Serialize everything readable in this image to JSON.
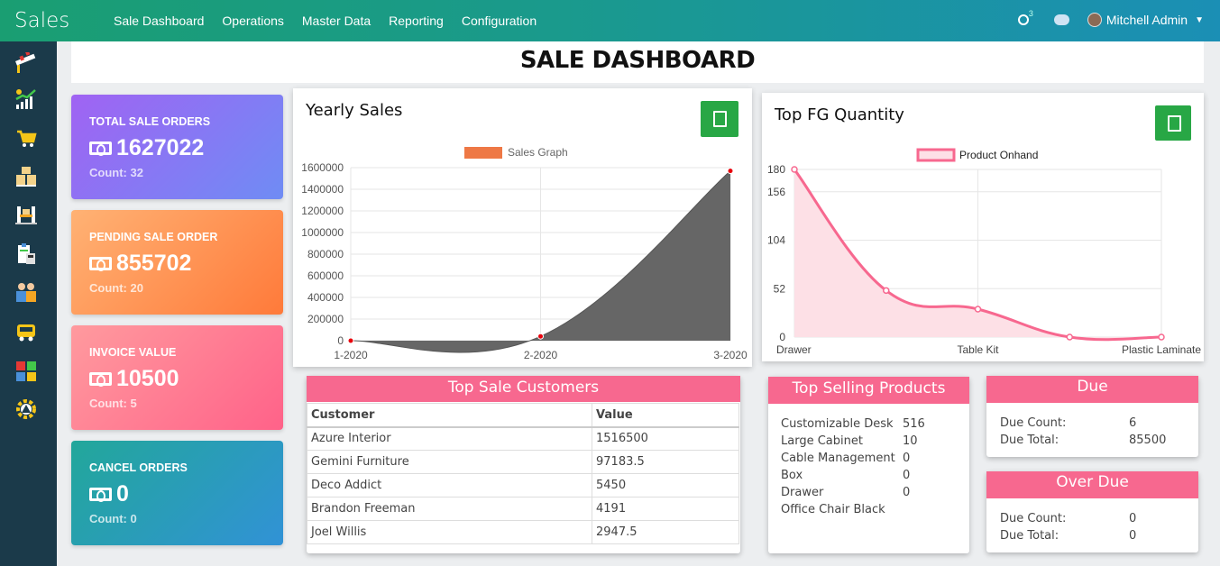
{
  "app": {
    "title": "Sales"
  },
  "topnav": [
    "Sale Dashboard",
    "Operations",
    "Master Data",
    "Reporting",
    "Configuration"
  ],
  "user": {
    "name": "Mitchell Admin",
    "activity_count": "3"
  },
  "page_title": "SALE DASHBOARD",
  "cards": [
    {
      "label": "TOTAL SALE ORDERS",
      "value": "1627022",
      "count": "Count: 32"
    },
    {
      "label": "PENDING SALE ORDER",
      "value": "855702",
      "count": "Count: 20"
    },
    {
      "label": "INVOICE VALUE",
      "value": "10500",
      "count": "Count: 5"
    },
    {
      "label": "CANCEL ORDERS",
      "value": "0",
      "count": "Count: 0"
    }
  ],
  "yearly": {
    "title": "Yearly Sales"
  },
  "topfg": {
    "title": "Top FG Quantity"
  },
  "chart_data": [
    {
      "type": "area",
      "title": "Yearly Sales",
      "legend": "Sales Graph",
      "x": [
        "1-2020",
        "2-2020",
        "3-2020"
      ],
      "values": [
        0,
        40000,
        1570000
      ],
      "ylim": [
        0,
        1600000
      ],
      "yticks": [
        "0",
        "200000",
        "400000",
        "600000",
        "800000",
        "1000000",
        "1200000",
        "1400000",
        "1600000"
      ],
      "colors": {
        "fill": "#666666",
        "legend": "#ee7845",
        "point": "#e8000b"
      }
    },
    {
      "type": "area",
      "title": "Top FG Quantity",
      "legend": "Product Onhand",
      "x": [
        "Drawer",
        "",
        "Table Kit",
        "",
        "Plastic Laminate"
      ],
      "values": [
        180,
        50,
        30,
        0,
        0
      ],
      "ylim": [
        0,
        180
      ],
      "yticks": [
        "0",
        "52",
        "104",
        "156",
        "180"
      ],
      "colors": {
        "line": "#f7688f",
        "fill": "#fde0e6"
      }
    }
  ],
  "customers": {
    "title": "Top Sale Customers",
    "headers": [
      "Customer",
      "Value"
    ],
    "rows": [
      [
        "Azure Interior",
        "1516500"
      ],
      [
        "Gemini Furniture",
        "97183.5"
      ],
      [
        "Deco Addict",
        "5450"
      ],
      [
        "Brandon Freeman",
        "4191"
      ],
      [
        "Joel Willis",
        "2947.5"
      ]
    ]
  },
  "products": {
    "title": "Top Selling Products",
    "rows": [
      [
        "Customizable Desk",
        "516"
      ],
      [
        "Large Cabinet",
        "10"
      ],
      [
        "Cable Management",
        "0"
      ],
      [
        "Box",
        "0"
      ],
      [
        "Drawer",
        "0"
      ],
      [
        "Office Chair Black",
        ""
      ]
    ]
  },
  "due": {
    "title": "Due",
    "count_label": "Due Count:",
    "count": "6",
    "total_label": "Due Total:",
    "total": "85500"
  },
  "overdue": {
    "title": "Over Due",
    "count_label": "Due Count:",
    "count": "0",
    "total_label": "Due Total:",
    "total": "0"
  }
}
